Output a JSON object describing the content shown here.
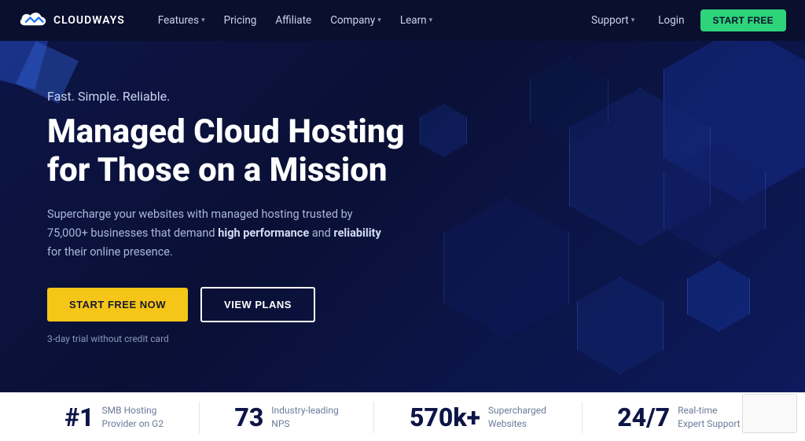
{
  "navbar": {
    "logo_text": "CLOUDWAYS",
    "nav_items": [
      {
        "label": "Features",
        "has_dropdown": true
      },
      {
        "label": "Pricing",
        "has_dropdown": false
      },
      {
        "label": "Affiliate",
        "has_dropdown": false
      },
      {
        "label": "Company",
        "has_dropdown": true
      },
      {
        "label": "Learn",
        "has_dropdown": true
      }
    ],
    "support_label": "Support",
    "login_label": "Login",
    "start_free_label": "START FREE"
  },
  "hero": {
    "tagline": "Fast. Simple. Reliable.",
    "title_line1": "Managed Cloud Hosting",
    "title_line2": "for Those on a Mission",
    "description": "Supercharge your websites with managed hosting trusted by 75,000+ businesses that demand",
    "desc_bold1": "high performance",
    "desc_and": " and ",
    "desc_bold2": "reliability",
    "desc_end": " for their online presence.",
    "btn_start": "START FREE NOW",
    "btn_plans": "VIEW PLANS",
    "trial_note": "3-day trial without credit card"
  },
  "stats": [
    {
      "number": "#1",
      "label": "SMB Hosting\nProvider on G2"
    },
    {
      "number": "73",
      "label": "Industry-leading\nNPS"
    },
    {
      "number": "570k+",
      "label": "Supercharged\nWebsites"
    },
    {
      "number": "24/7",
      "label": "Real-time\nExpert Support"
    }
  ]
}
